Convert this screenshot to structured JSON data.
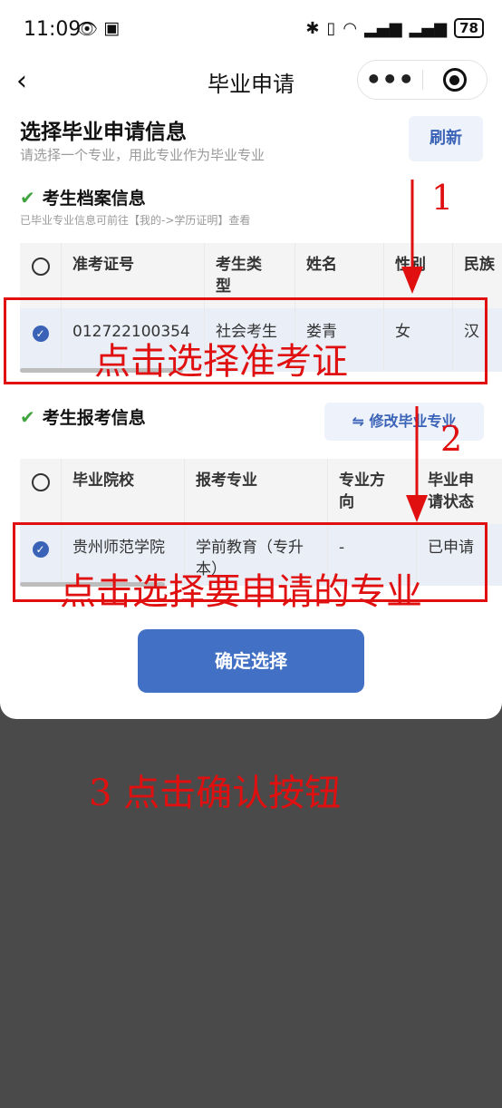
{
  "status": {
    "time": "11:09",
    "battery": "78"
  },
  "nav": {
    "title": "毕业申请"
  },
  "header": {
    "title": "选择毕业申请信息",
    "subtitle": "请选择一个专业，用此专业作为毕业专业",
    "refresh_label": "刷新"
  },
  "archive": {
    "title": "考生档案信息",
    "note": "已毕业专业信息可前往【我的->学历证明】查看",
    "columns": [
      "准考证号",
      "考生类\n型",
      "姓名",
      "性别",
      "民族"
    ],
    "row": {
      "exam_no": "012722100354",
      "type": "社会考生",
      "name": "娄青",
      "gender": "女",
      "ethnicity": "汉"
    }
  },
  "enroll": {
    "title": "考生报考信息",
    "modify_label": "⇋ 修改毕业专业",
    "columns": [
      "毕业院校",
      "报考专业",
      "专业方\n向",
      "毕业申\n请状态"
    ],
    "row": {
      "school": "贵州师范学院",
      "major": "学前教育（专升\n本）",
      "direction": "-",
      "status": "已申请"
    }
  },
  "confirm_label": "确定选择",
  "annotations": {
    "a1": "1",
    "a1_text": "点击选择准考证",
    "a2": "2",
    "a2_text": "点击选择要申请的专业",
    "a3_text": "3 点击确认按钮"
  },
  "colors": {
    "accent": "#4170c4",
    "annotation": "#e01010",
    "check": "#3fa33f"
  }
}
